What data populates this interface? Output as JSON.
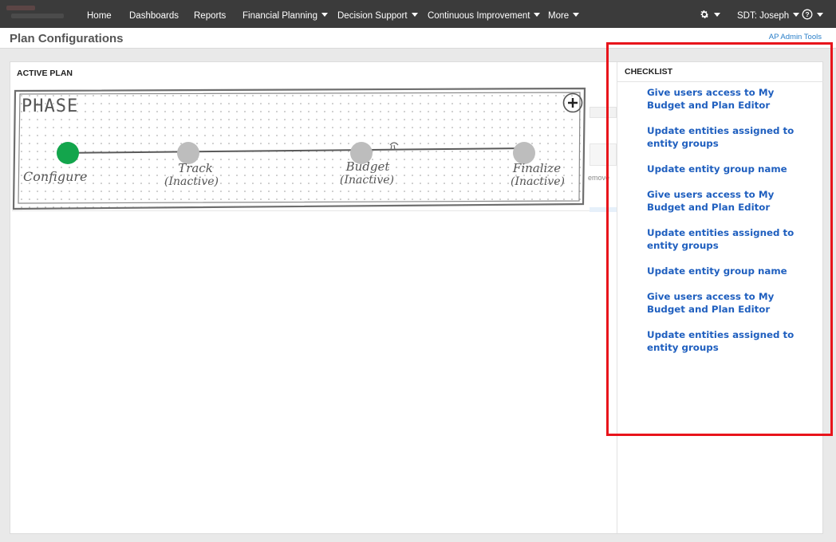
{
  "nav": {
    "items": [
      {
        "label": "Home",
        "dropdown": false
      },
      {
        "label": "Dashboards",
        "dropdown": false
      },
      {
        "label": "Reports",
        "dropdown": false
      },
      {
        "label": "Financial Planning",
        "dropdown": true
      },
      {
        "label": "Decision Support",
        "dropdown": true
      },
      {
        "label": "Continuous Improvement",
        "dropdown": true
      },
      {
        "label": "More",
        "dropdown": true
      }
    ],
    "user_label": "SDT: Joseph",
    "icons": {
      "settings": "gear-icon",
      "help": "question-circle-icon"
    }
  },
  "page": {
    "title": "Plan Configurations",
    "admin_link": "AP Admin Tools"
  },
  "active_plan": {
    "title": "ACTIVE PLAN",
    "sketch": {
      "heading": "PHASE",
      "add_icon": "plus-circle-icon",
      "phases": [
        {
          "name": "Configure",
          "status": "",
          "active": true
        },
        {
          "name": "Track",
          "status": "(Inactive)",
          "active": false
        },
        {
          "name": "Budget",
          "status": "(Inactive)",
          "active": false
        },
        {
          "name": "Finalize",
          "status": "(Inactive)",
          "active": false
        }
      ]
    },
    "background_fragment": "emove"
  },
  "checklist": {
    "title": "CHECKLIST",
    "items": [
      "Give users access to My Budget and Plan Editor",
      "Update entities assigned to entity groups",
      "Update entity group name",
      "Give users access to My Budget and Plan Editor",
      "Update entities assigned to entity groups",
      "Update entity group name",
      "Give users access to My Budget and Plan Editor",
      "Update entities assigned to entity groups"
    ]
  },
  "colors": {
    "nav_bg": "#3b3b3b",
    "link_blue": "#1f5fbf",
    "active_phase": "#13a54c",
    "inactive_phase": "#bdbdbd",
    "highlight_red": "#e8141b"
  }
}
